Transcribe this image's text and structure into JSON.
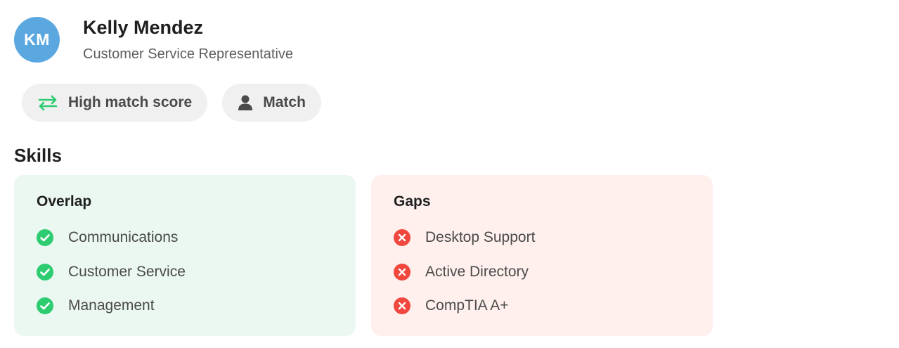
{
  "profile": {
    "initials": "KM",
    "name": "Kelly Mendez",
    "title": "Customer Service Representative",
    "avatar_color": "#5ba8e0"
  },
  "badges": [
    {
      "label": "High match score",
      "icon": "swap-arrows-icon",
      "icon_color": "#2ecc71"
    },
    {
      "label": "Match",
      "icon": "person-icon",
      "icon_color": "#4a4a4a"
    }
  ],
  "skills": {
    "heading": "Skills",
    "overlap": {
      "title": "Overlap",
      "color": "#2ecc71",
      "items": [
        "Communications",
        "Customer Service",
        "Management"
      ]
    },
    "gaps": {
      "title": "Gaps",
      "color": "#f0483e",
      "items": [
        "Desktop Support",
        "Active Directory",
        "CompTIA A+"
      ]
    }
  }
}
